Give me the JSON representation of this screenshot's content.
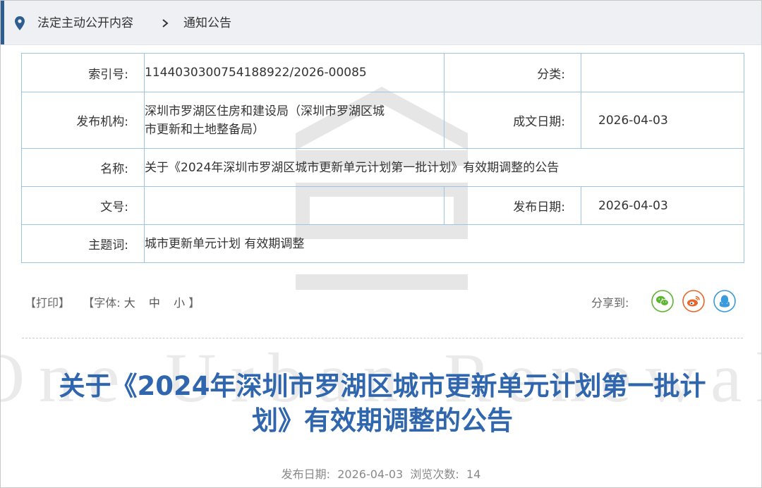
{
  "breadcrumb": {
    "items": [
      "法定主动公开内容",
      "通知公告"
    ]
  },
  "meta": {
    "index_label": "索引号:",
    "index_value": "1144030300754188922/2026-00085",
    "category_label": "分类:",
    "category_value": "",
    "publisher_label": "发布机构:",
    "publisher_value_line1": "深圳市罗湖区住房和建设局（深圳市罗湖区城",
    "publisher_value_line2": "市更新和土地整备局）",
    "created_label": "成文日期:",
    "created_value": "2026-04-03",
    "name_label": "名称:",
    "name_value": "关于《2024年深圳市罗湖区城市更新单元计划第一批计划》有效期调整的公告",
    "docno_label": "文号:",
    "docno_value": "",
    "pubdate_label": "发布日期:",
    "pubdate_value": "2026-04-03",
    "keywords_label": "主题词:",
    "keywords_value": "城市更新单元计划 有效期调整"
  },
  "tools": {
    "print": "【打印】",
    "font_prefix": "【字体:",
    "font_large": "大",
    "font_medium": "中",
    "font_small": "小",
    "font_suffix": "】"
  },
  "share": {
    "label": "分享到:",
    "icons": [
      "wechat-icon",
      "weibo-icon",
      "qq-icon"
    ],
    "colors": {
      "wechat": "#5cb531",
      "weibo": "#e8652b",
      "qq": "#3a9bdc"
    }
  },
  "article": {
    "title_line1": "关于《2024年深圳市罗湖区城市更新单元计划第一批计",
    "title_line2": "划》有效期调整的公告",
    "footer": "发布日期:  2026-04-03  浏览次数:  14"
  },
  "watermark": {
    "text": "One Urban Renewal"
  },
  "colors": {
    "accent": "#2f5d8f",
    "title": "#2f66ad",
    "table_border": "#9cc4e6"
  }
}
